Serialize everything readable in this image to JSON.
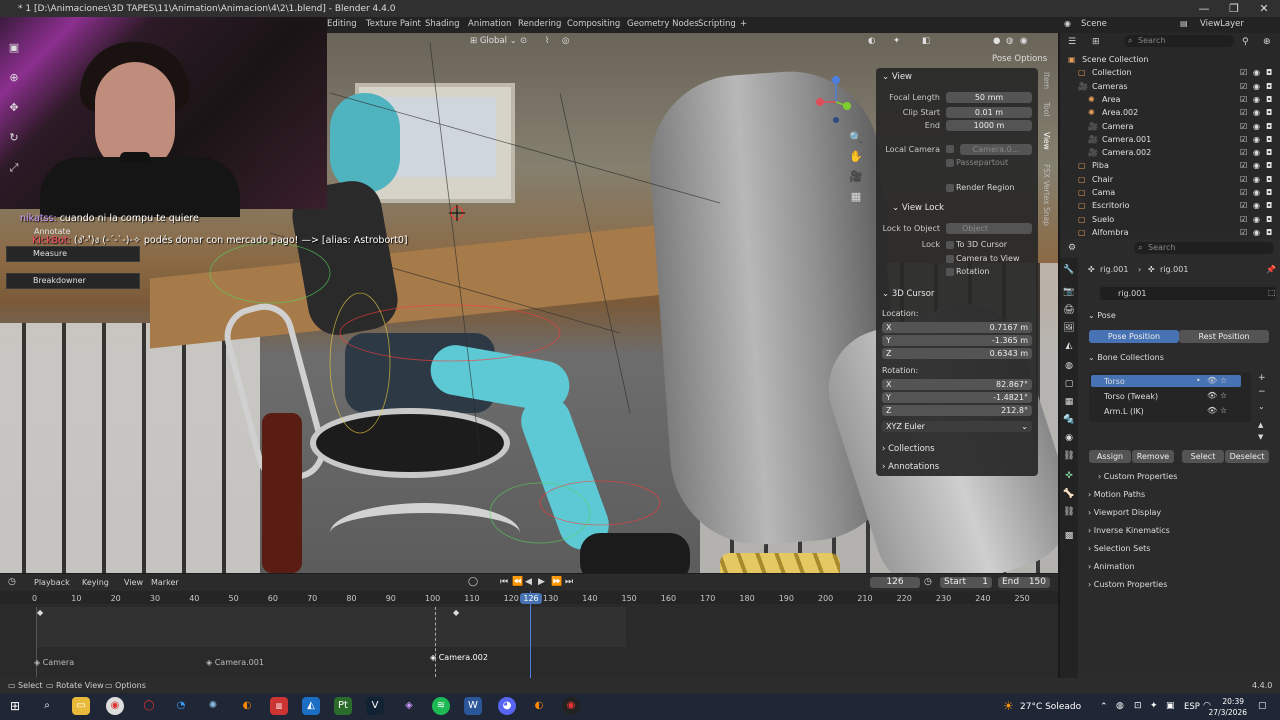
{
  "window": {
    "title": "* 1 [D:\\Animaciones\\3D TAPES\\11\\Animation\\Animacion\\4\\2\\1.blend] - Blender 4.4.0",
    "minimize": "—",
    "maximize": "❐",
    "close": "✕"
  },
  "workspaces": [
    "Editing",
    "Texture Paint",
    "Shading",
    "Animation",
    "Rendering",
    "Compositing",
    "Geometry Nodes",
    "Scripting",
    "+"
  ],
  "scene": {
    "name": "Scene",
    "view_layer": "ViewLayer"
  },
  "viewport": {
    "orientation": "Global",
    "pose_options": "Pose Options",
    "tool_labels": {
      "annotate": "Annotate",
      "measure": "Measure",
      "breakdowner": "Breakdowner"
    }
  },
  "chat": [
    {
      "user": "nikatss:",
      "message": "cuando ni la compu te quiere"
    },
    {
      "user": "KickBot:",
      "message": "(ง'̀-'́)ง (-´-`-)-✧ podés donar con mercado pago! —> [alias: Astrobort0]"
    }
  ],
  "npanel": {
    "view_header": "View",
    "focal_length_label": "Focal Length",
    "focal_length": "50 mm",
    "clip_start_label": "Clip Start",
    "clip_start": "0.01 m",
    "end_label": "End",
    "end": "1000 m",
    "local_camera_label": "Local Camera",
    "local_camera": "Camera.0...",
    "passepartout": "Passepartout",
    "render_region": "Render Region",
    "view_lock_header": "View Lock",
    "lock_to_object_label": "Lock to Object",
    "lock_to_object_placeholder": "Object",
    "lock_label": "Lock",
    "to_3d_cursor": "To 3D Cursor",
    "camera_to_view": "Camera to View",
    "rotation_lock": "Rotation",
    "cursor_header": "3D Cursor",
    "location_label": "Location:",
    "loc_x": "0.7167 m",
    "loc_y": "-1.365 m",
    "loc_z": "0.6343 m",
    "rotation_label": "Rotation:",
    "rot_x": "82.867°",
    "rot_y": "-1.4821°",
    "rot_z": "212.8°",
    "rotation_mode": "XYZ Euler",
    "collections_header": "Collections",
    "annotations_header": "Annotations",
    "axis_x": "X",
    "axis_y": "Y",
    "axis_z": "Z",
    "tabs": [
      "Item",
      "Tool",
      "View",
      "FSX Vertex Snap"
    ]
  },
  "timeline": {
    "menu": [
      "Playback",
      "Keying",
      "View",
      "Marker"
    ],
    "current_frame": "126",
    "start_label": "Start",
    "start": "1",
    "end_label": "End",
    "end": "150",
    "ticks": [
      "0",
      "10",
      "20",
      "30",
      "40",
      "50",
      "60",
      "70",
      "80",
      "90",
      "100",
      "110",
      "120",
      "130",
      "140",
      "150",
      "160",
      "170",
      "180",
      "190",
      "200",
      "210",
      "220",
      "230",
      "240",
      "250"
    ],
    "markers": [
      "Camera",
      "Camera.001",
      "Camera.002"
    ]
  },
  "statusbar": {
    "select": "Select",
    "rotate_view": "Rotate View",
    "options": "Options",
    "version": "4.4.0"
  },
  "outliner": {
    "search_placeholder": "Search",
    "items": [
      {
        "label": "Scene Collection",
        "indent": 0
      },
      {
        "label": "Collection",
        "indent": 1
      },
      {
        "label": "Cameras",
        "indent": 1
      },
      {
        "label": "Area",
        "indent": 2
      },
      {
        "label": "Area.002",
        "indent": 2
      },
      {
        "label": "Camera",
        "indent": 2
      },
      {
        "label": "Camera.001",
        "indent": 2
      },
      {
        "label": "Camera.002",
        "indent": 2
      },
      {
        "label": "Piba",
        "indent": 1
      },
      {
        "label": "Chair",
        "indent": 1
      },
      {
        "label": "Cama",
        "indent": 1
      },
      {
        "label": "Escritorio",
        "indent": 1
      },
      {
        "label": "Suelo",
        "indent": 1
      },
      {
        "label": "Alfombra",
        "indent": 1
      }
    ]
  },
  "properties": {
    "search_placeholder": "Search",
    "breadcrumb_a": "rig.001",
    "breadcrumb_b": "rig.001",
    "armature_name": "rig.001",
    "pose_header": "Pose",
    "pose_position": "Pose Position",
    "rest_position": "Rest Position",
    "bone_collections_header": "Bone Collections",
    "bone_collections": [
      "Torso",
      "Torso (Tweak)",
      "Arm.L (IK)"
    ],
    "assign": "Assign",
    "remove": "Remove",
    "select": "Select",
    "deselect": "Deselect",
    "sections": [
      "Custom Properties",
      "Motion Paths",
      "Viewport Display",
      "Inverse Kinematics",
      "Selection Sets",
      "Animation",
      "Custom Properties"
    ]
  },
  "taskbar": {
    "weather": "27°C  Soleado",
    "lang": "ESP",
    "time": "20:39",
    "date": "27/3/2026"
  }
}
